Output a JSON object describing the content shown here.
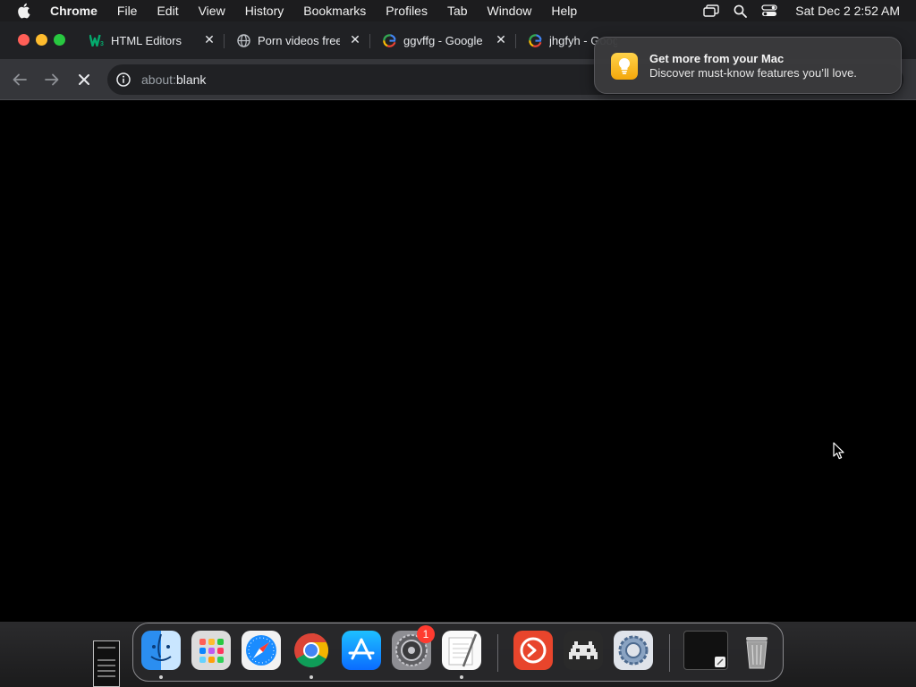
{
  "menubar": {
    "app_name": "Chrome",
    "items": [
      "File",
      "Edit",
      "View",
      "History",
      "Bookmarks",
      "Profiles",
      "Tab",
      "Window",
      "Help"
    ],
    "clock": "Sat Dec 2  2:52 AM"
  },
  "tabs": [
    {
      "title": "HTML Editors",
      "favicon": "w3schools-icon"
    },
    {
      "title": "Porn videos free",
      "favicon": "globe-icon"
    },
    {
      "title": "ggvffg - Google",
      "favicon": "google-icon"
    },
    {
      "title": "jhgfyh - Google",
      "favicon": "google-icon"
    }
  ],
  "toolbar": {
    "url_scheme": "about:",
    "url_path": "blank"
  },
  "notification": {
    "title": "Get more from your Mac",
    "body": "Discover must-know features you’ll love."
  },
  "dock": {
    "apps": [
      "Finder",
      "Launchpad",
      "Safari",
      "Google Chrome",
      "App Store",
      "System Settings",
      "TextEdit",
      "Microsoft Remote Desktop",
      "Retro Game",
      "System Preferences"
    ],
    "settings_badge": "1"
  },
  "colors": {
    "menubar": "#1c1c1e",
    "tabstrip": "#202124",
    "toolbar": "#35363a",
    "content": "#000000"
  }
}
